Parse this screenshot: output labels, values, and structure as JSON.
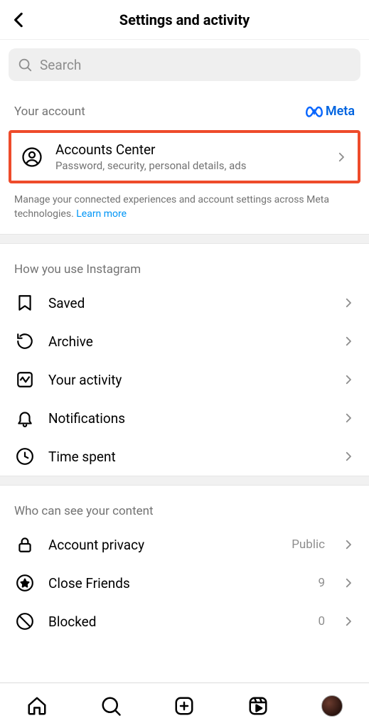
{
  "header": {
    "title": "Settings and activity"
  },
  "search": {
    "placeholder": "Search"
  },
  "your_account": {
    "label": "Your account",
    "brand": "Meta",
    "item": {
      "title": "Accounts Center",
      "subtitle": "Password, security, personal details, ads"
    },
    "description": "Manage your connected experiences and account settings across Meta technologies. ",
    "learn_more": "Learn more"
  },
  "usage": {
    "label": "How you use Instagram",
    "items": [
      {
        "title": "Saved"
      },
      {
        "title": "Archive"
      },
      {
        "title": "Your activity"
      },
      {
        "title": "Notifications"
      },
      {
        "title": "Time spent"
      }
    ]
  },
  "visibility": {
    "label": "Who can see your content",
    "items": [
      {
        "title": "Account privacy",
        "value": "Public"
      },
      {
        "title": "Close Friends",
        "value": "9"
      },
      {
        "title": "Blocked",
        "value": "0"
      }
    ]
  }
}
